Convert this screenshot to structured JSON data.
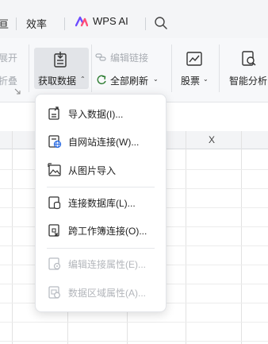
{
  "tabs": {
    "partial_left": "亘",
    "efficiency": "效率",
    "wps_ai": "WPS AI"
  },
  "colors": {
    "accent_ai": "#6c4bff",
    "accent_ai_2": "#ff4f78",
    "icon_blue": "#2f6fe4"
  },
  "ribbon": {
    "expand_partial": "展开",
    "fold_partial": "折叠",
    "get_data": {
      "label": "获取数据",
      "caret": "⌃"
    },
    "edit_links": {
      "label": "编辑链接"
    },
    "refresh_all": {
      "label": "全部刷新",
      "caret": "⌄"
    },
    "stocks": {
      "label": "股票",
      "caret": "⌄"
    },
    "smart_analysis": {
      "label": "智能分析"
    }
  },
  "sheet": {
    "column_x": "X"
  },
  "menu": {
    "items": [
      {
        "label": "导入数据(I)...",
        "icon": "import-data-icon",
        "enabled": true
      },
      {
        "label": "自网站连接(W)...",
        "icon": "web-connect-icon",
        "enabled": true
      },
      {
        "label": "从图片导入",
        "icon": "image-import-icon",
        "enabled": true
      },
      {
        "label": "连接数据库(L)...",
        "icon": "database-connect-icon",
        "enabled": true
      },
      {
        "label": "跨工作簿连接(O)...",
        "icon": "workbook-link-icon",
        "enabled": true
      },
      {
        "label": "编辑连接属性(E)...",
        "icon": "connection-props-icon",
        "enabled": false
      },
      {
        "label": "数据区域属性(A)...",
        "icon": "range-props-icon",
        "enabled": false
      }
    ]
  }
}
